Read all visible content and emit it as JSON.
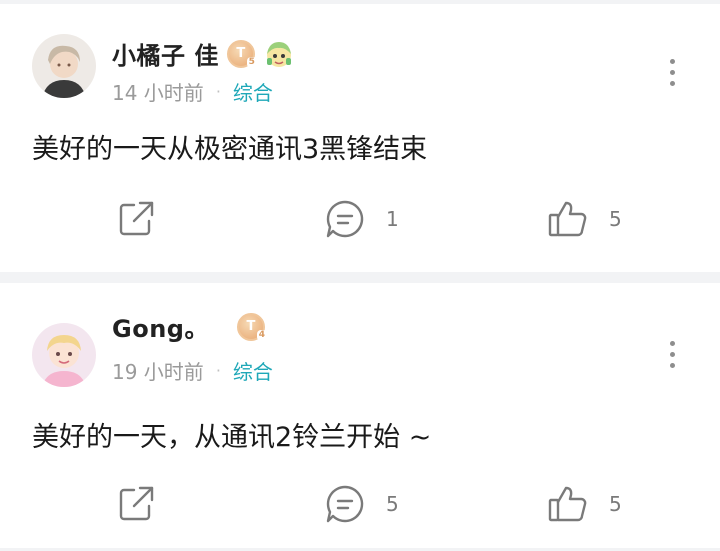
{
  "posts": [
    {
      "author": "小橘子 佳",
      "badge_letter": "T",
      "badge_level": "5",
      "time": "14 小时前",
      "separator": "·",
      "category": "综合",
      "content": "美好的一天从极密通讯3黑锋结束",
      "comment_count": "1",
      "like_count": "5"
    },
    {
      "author": "Gong。",
      "badge_letter": "T",
      "badge_level": "4",
      "time": "19 小时前",
      "separator": "·",
      "category": "综合",
      "content": "美好的一天，从通讯2铃兰开始 ~",
      "comment_count": "5",
      "like_count": "5"
    }
  ],
  "colors": {
    "accent": "#1fa8b8",
    "meta_gray": "#9a9a9a",
    "icon_gray": "#7a7a7a",
    "background": "#f2f3f5",
    "badge": "#e8a770"
  }
}
